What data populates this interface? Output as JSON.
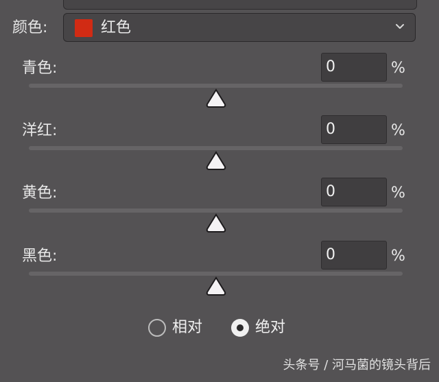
{
  "selection": {
    "label": "颜色:",
    "value": "红色",
    "swatch_color": "#d12b14"
  },
  "sliders": [
    {
      "label": "青色:",
      "value": "0",
      "unit": "%",
      "fraction": 0.5
    },
    {
      "label": "洋红:",
      "value": "0",
      "unit": "%",
      "fraction": 0.5
    },
    {
      "label": "黄色:",
      "value": "0",
      "unit": "%",
      "fraction": 0.5
    },
    {
      "label": "黑色:",
      "value": "0",
      "unit": "%",
      "fraction": 0.5
    }
  ],
  "mode": {
    "options": [
      {
        "label": "相对",
        "selected": false
      },
      {
        "label": "绝对",
        "selected": true
      }
    ]
  },
  "watermark": "头条号 / 河马菌的镜头背后"
}
